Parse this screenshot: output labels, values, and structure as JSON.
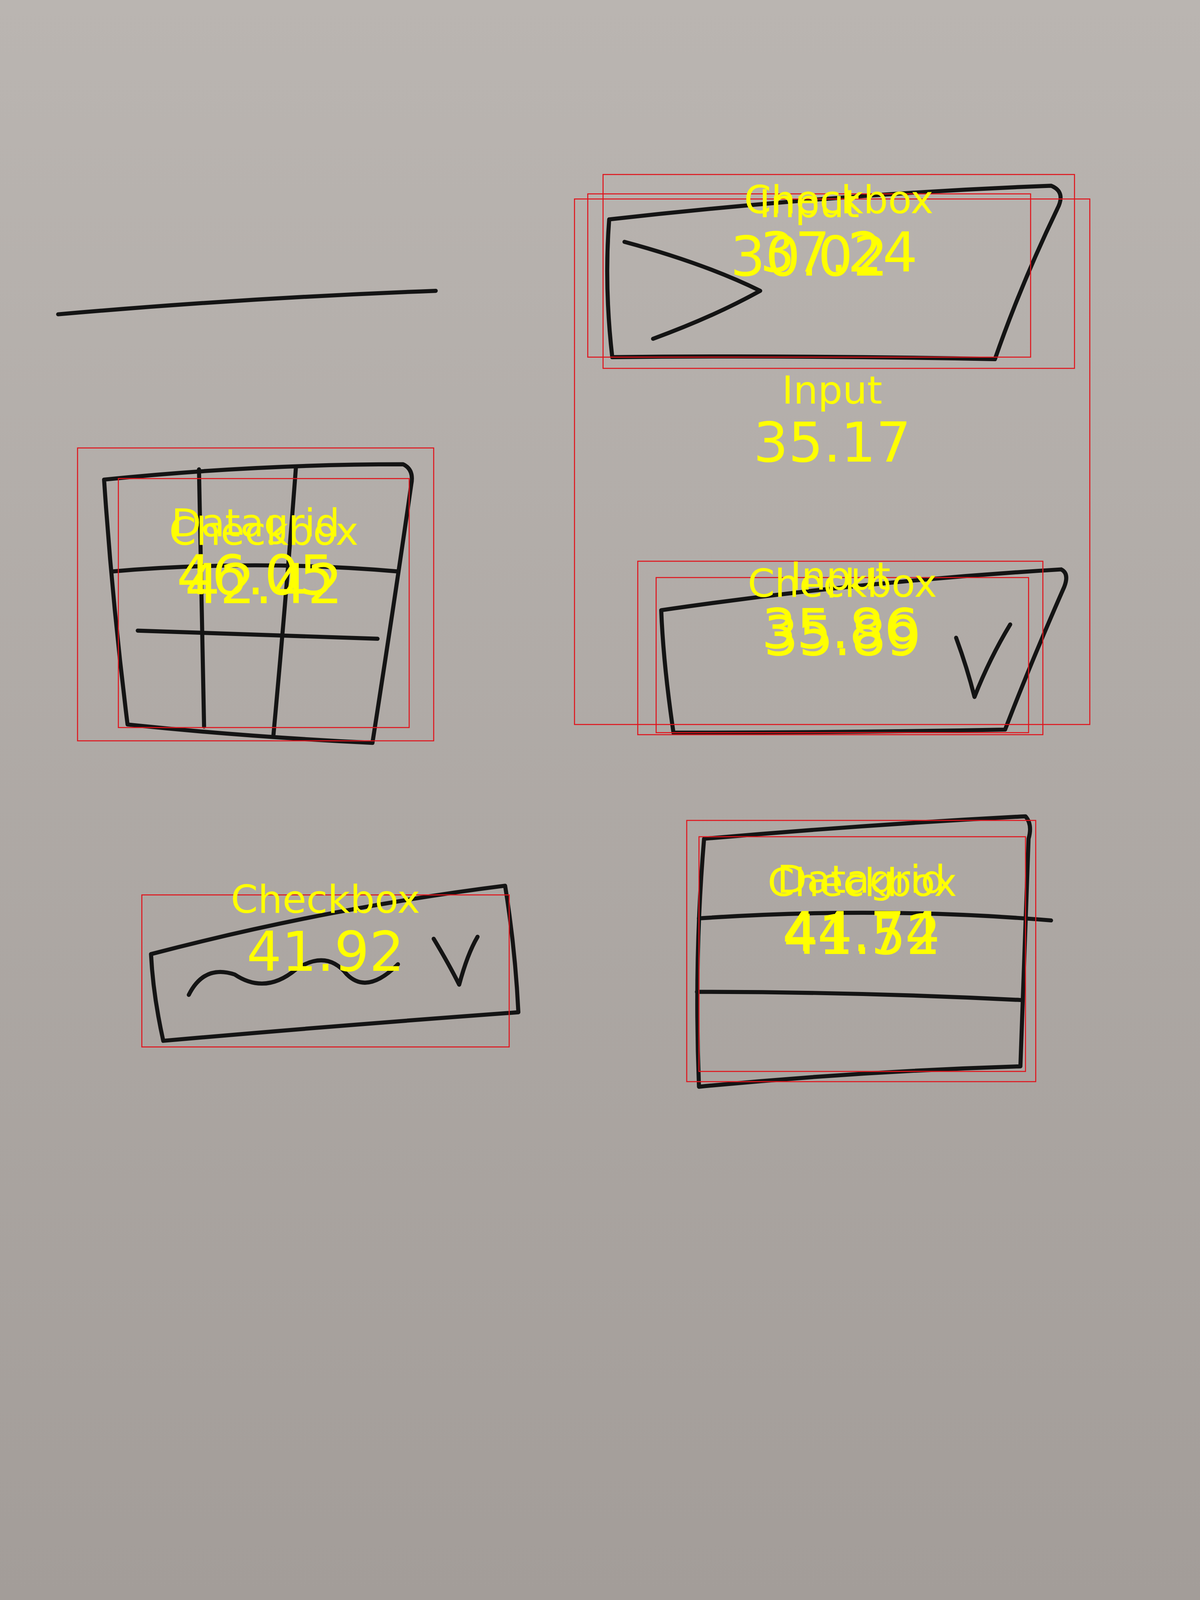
{
  "detections": [
    {
      "label": "Checkbox",
      "score": "37.24"
    },
    {
      "label": "Input",
      "score": "30.02"
    },
    {
      "label": "Input",
      "score": "35.17"
    },
    {
      "label": "Input",
      "score": "35.86"
    },
    {
      "label": "Checkbox",
      "score": "35.89"
    },
    {
      "label": "Datagrid",
      "score": "46.05"
    },
    {
      "label": "Checkbox",
      "score": "42.42"
    },
    {
      "label": "Checkbox",
      "score": "41.92"
    },
    {
      "label": "Datagrid",
      "score": "44.74"
    },
    {
      "label": "Checkbox",
      "score": "41.52"
    }
  ]
}
